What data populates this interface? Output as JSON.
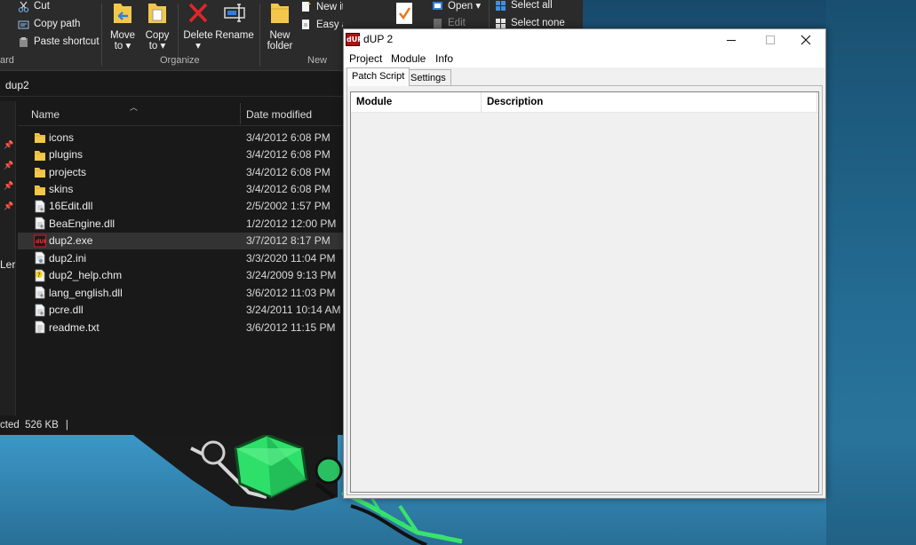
{
  "explorer": {
    "ribbon": {
      "clipboard": {
        "cut_label": "Cut",
        "copy_path_label": "Copy path",
        "paste_shortcut_label": "Paste shortcut",
        "group_label": "ard"
      },
      "organize": {
        "move_to_label": "Move",
        "move_to_label2": "to",
        "copy_to_label": "Copy",
        "copy_to_label2": "to",
        "delete_label": "Delete",
        "rename_label": "Rename",
        "group_label": "Organize"
      },
      "new": {
        "new_folder_label": "New",
        "new_folder_label2": "folder",
        "new_item_label": "New item",
        "easy_access_label": "Easy access",
        "group_label": "New"
      },
      "open": {
        "open_label": "Open",
        "edit_label": "Edit"
      },
      "select": {
        "select_all_label": "Select all",
        "select_none_label": "Select none"
      }
    },
    "address": "dup2",
    "columns": {
      "name": "Name",
      "date_modified": "Date modified"
    },
    "files": [
      {
        "name": "icons",
        "date": "3/4/2012 6:08 PM",
        "icon": "folder-icon"
      },
      {
        "name": "plugins",
        "date": "3/4/2012 6:08 PM",
        "icon": "folder-icon"
      },
      {
        "name": "projects",
        "date": "3/4/2012 6:08 PM",
        "icon": "folder-icon"
      },
      {
        "name": "skins",
        "date": "3/4/2012 6:08 PM",
        "icon": "folder-icon"
      },
      {
        "name": "16Edit.dll",
        "date": "2/5/2002 1:57 PM",
        "icon": "dll-file-icon"
      },
      {
        "name": "BeaEngine.dll",
        "date": "1/2/2012 12:00 PM",
        "icon": "dll-file-icon"
      },
      {
        "name": "dup2.exe",
        "date": "3/7/2012 8:17 PM",
        "icon": "dup-exe-icon",
        "selected": true
      },
      {
        "name": "dup2.ini",
        "date": "3/3/2020 11:04 PM",
        "icon": "ini-file-icon"
      },
      {
        "name": "dup2_help.chm",
        "date": "3/24/2009 9:13 PM",
        "icon": "chm-help-file-icon"
      },
      {
        "name": "lang_english.dll",
        "date": "3/6/2012 11:03 PM",
        "icon": "dll-file-icon"
      },
      {
        "name": "pcre.dll",
        "date": "3/24/2011 10:14 AM",
        "icon": "dll-file-icon"
      },
      {
        "name": "readme.txt",
        "date": "3/6/2012 11:15 PM",
        "icon": "text-file-icon"
      }
    ],
    "nav_partial_label": "Ler",
    "status": {
      "selection_text": "cted  526 KB",
      "divider": "|"
    }
  },
  "dup": {
    "title": "dUP 2",
    "logo_text": "dUP",
    "menu": [
      "Project",
      "Module",
      "Info"
    ],
    "tabs": [
      "Patch Script",
      "Settings"
    ],
    "list_columns": [
      "Module",
      "Description"
    ],
    "caption_buttons": {
      "minimize": "minimize-icon",
      "maximize": "maximize-icon",
      "close": "close-icon"
    }
  },
  "colors": {
    "explorer_bg": "#191919",
    "ribbon_bg": "#2b2b2b",
    "folder_yellow": "#f3c74a",
    "delete_red": "#e0262a",
    "dup_window_bg": "#f0f0f0",
    "wallpaper_blue": "#2b7aa3",
    "neon_green": "#39e36a"
  }
}
